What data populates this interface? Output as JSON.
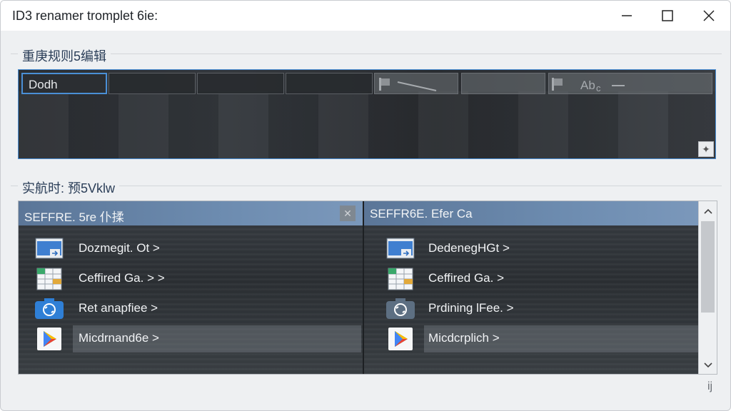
{
  "window": {
    "title": "ID3 renamer tromplet 6ie:",
    "controls": {
      "minimize": "minimize-icon",
      "maximize": "maximize-icon",
      "close": "close-icon"
    }
  },
  "editor_group": {
    "label": "重庚规则5编辑",
    "cells": [
      "Dodh",
      "",
      "",
      ""
    ],
    "toolbar_icons": [
      "flag-icon",
      "pen-icon",
      "flag-icon",
      "text-style-icon",
      "minus-icon"
    ],
    "corner_icon": "plus-icon"
  },
  "preview_group": {
    "label": "实航时: 预5Vklw",
    "left_pane": {
      "header": "SEFFRE. 5re 仆揉",
      "close_icon": "close-icon",
      "rows": [
        {
          "icon": "window-arrow-icon",
          "label": "Dozmegit. Ot >"
        },
        {
          "icon": "spreadsheet-icon",
          "label": "Ceffired Ga. > >"
        },
        {
          "icon": "camera-sync-icon",
          "label": "Ret anapfiee >"
        },
        {
          "icon": "play-store-icon",
          "label": "Micdrnand6e >"
        }
      ],
      "selected_index": 3
    },
    "right_pane": {
      "header": "SEFFR6E. Efer Ca",
      "rows": [
        {
          "icon": "window-arrow-icon",
          "label": "DedenegHGt >"
        },
        {
          "icon": "spreadsheet-icon",
          "label": "Ceffired Ga. >"
        },
        {
          "icon": "camera-sync-icon",
          "label": "Prdining lFee. >"
        },
        {
          "icon": "play-store-icon",
          "label": "Micdcrplich >"
        }
      ],
      "selected_index": 3
    },
    "scrollbar": {
      "up": "chevron-up-icon",
      "down": "chevron-down-icon"
    }
  },
  "status": {
    "grip": "ij"
  }
}
